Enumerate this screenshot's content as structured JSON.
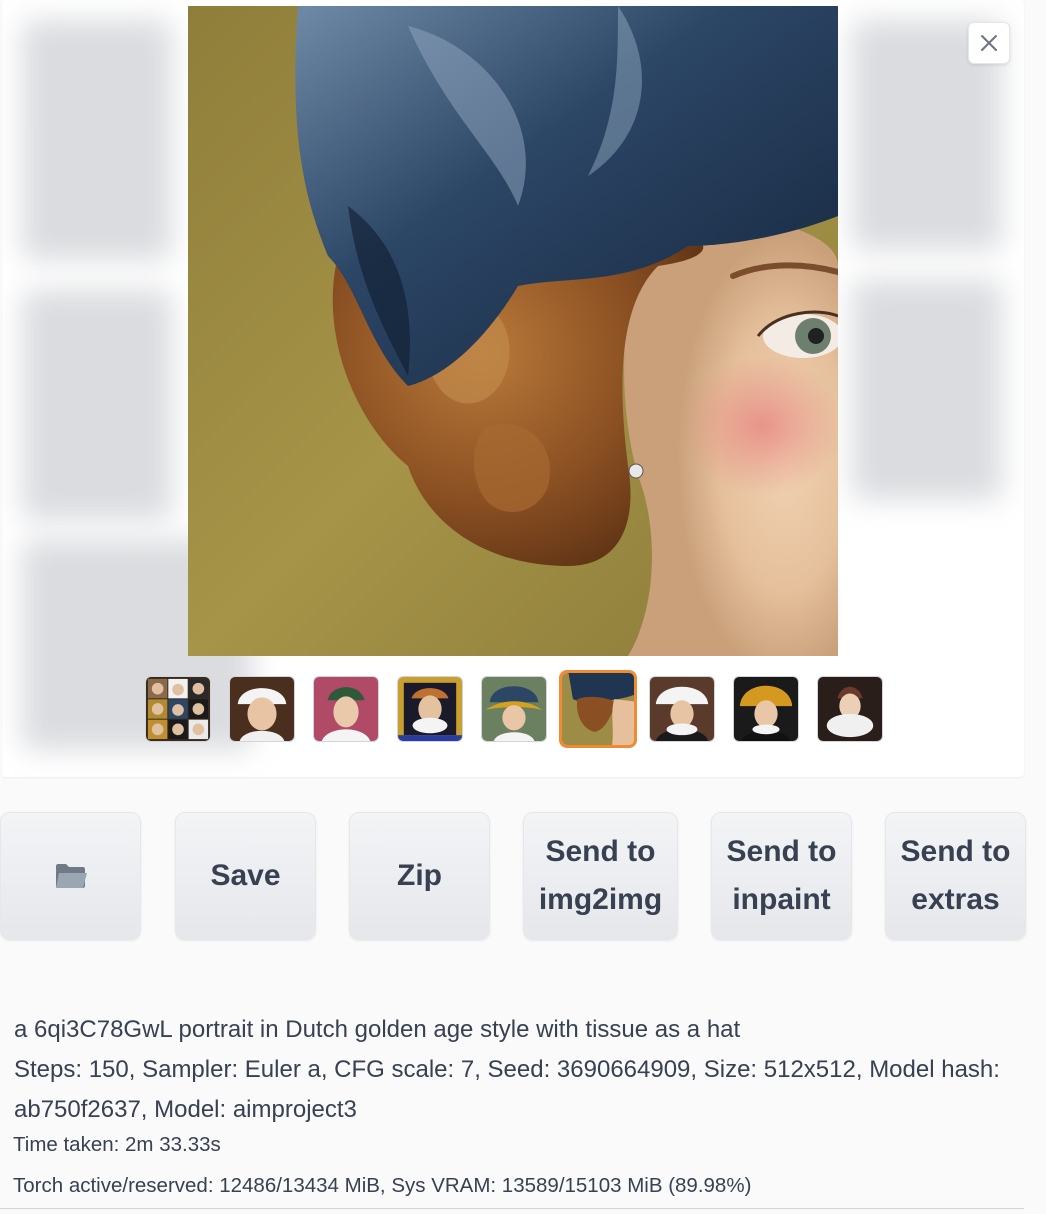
{
  "gallery": {
    "main_image_alt": "portrait",
    "close_icon": "close-icon",
    "thumbnails": [
      "grid",
      "white-cap",
      "pink-bg",
      "gold-frame",
      "blue-gold-hat",
      "selected-blue-hat",
      "white-hat",
      "gold-hat",
      "brown-veil"
    ],
    "selected_index": 5
  },
  "toolbar": {
    "folder_icon": "folder-icon",
    "save_label": "Save",
    "zip_label": "Zip",
    "send_img2img_line1": "Send to",
    "send_img2img_line2": "img2img",
    "send_inpaint_line1": "Send to",
    "send_inpaint_line2": "inpaint",
    "send_extras_line1": "Send to",
    "send_extras_line2": "extras"
  },
  "info": {
    "prompt": "a 6qi3C78GwL portrait in Dutch golden age style with tissue as a hat",
    "params": "Steps: 150, Sampler: Euler a, CFG scale: 7, Seed: 3690664909, Size: 512x512, Model hash: ab750f2637, Model: aimproject3",
    "time_taken": "Time taken: 2m 33.33s",
    "memory": "Torch active/reserved: 12486/13434 MiB, Sys VRAM: 13589/15103 MiB (89.98%)"
  },
  "colors": {
    "accent": "#f28a32",
    "canvas_bg": "#9c8c45",
    "hat_blue": "#1f3552"
  }
}
